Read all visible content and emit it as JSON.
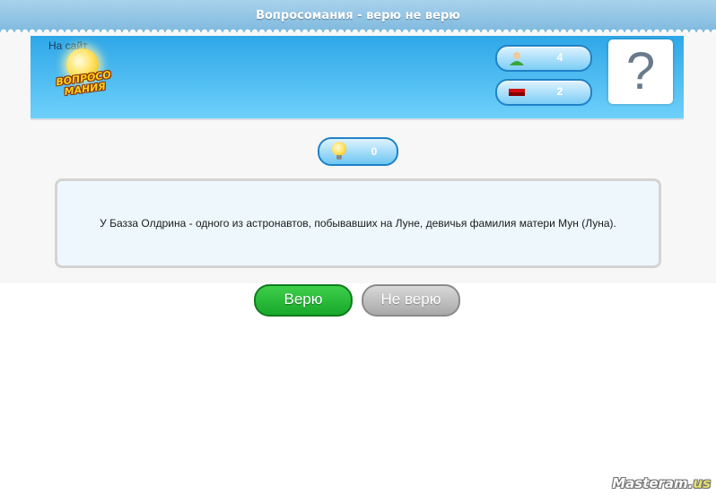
{
  "window": {
    "title": "Вопросомания - верю не верю"
  },
  "header": {
    "site_link": "На сайт",
    "logo_text": "ВОПРОСО МАНИЯ",
    "players_count": "4",
    "errors_count": "2",
    "help_mark": "?"
  },
  "hints": {
    "count": "0"
  },
  "question": {
    "text": "У Базза Олдрина - одного из астронавтов, побывавших на Луне, девичья фамилия матери Мун (Луна)."
  },
  "answers": {
    "believe_label": "Верю",
    "disbelieve_label": "Не верю"
  },
  "watermark": {
    "main": "Masteram.",
    "accent": "us"
  },
  "colors": {
    "header_blue": "#2ea7e8",
    "believe_green": "#18a82a",
    "disbelieve_gray": "#a9a9a9"
  },
  "icons": [
    "player-icon",
    "error-flag-icon",
    "lightbulb-icon",
    "help-icon"
  ]
}
